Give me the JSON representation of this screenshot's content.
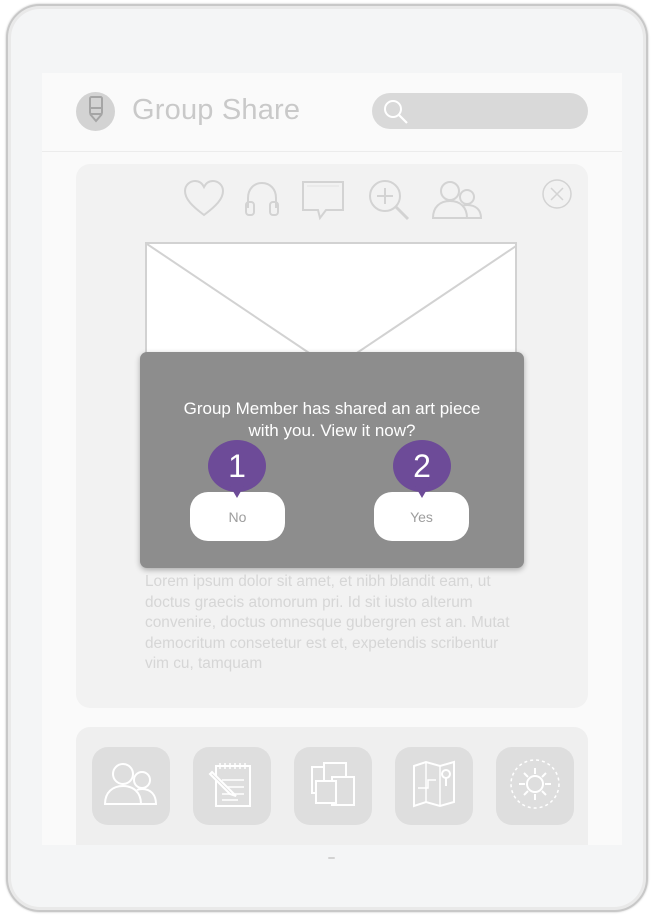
{
  "app": {
    "title": "Group Share",
    "logo_icon": "pencil-icon"
  },
  "search": {
    "placeholder": "",
    "icon": "search-icon"
  },
  "card": {
    "actions": [
      {
        "name": "heart-icon"
      },
      {
        "name": "headphones-icon"
      },
      {
        "name": "comment-icon"
      },
      {
        "name": "zoom-in-icon"
      },
      {
        "name": "group-icon"
      }
    ],
    "close_icon": "close-icon",
    "body_text": "Lorem ipsum dolor sit amet, et nibh blandit eam, ut doctus graecis atomorum pri. Id sit iusto alterum convenire, doctus omnesque gubergren est an. Mutat democritum consetetur est et, expetendis scribentur vim cu, tamquam"
  },
  "modal": {
    "message_line1": "Group Member has shared an art piece",
    "message_line2": "with you. View it now?",
    "no_label": "No",
    "yes_label": "Yes",
    "marker_no": "1",
    "marker_yes": "2"
  },
  "dock": {
    "items": [
      {
        "name": "members-icon"
      },
      {
        "name": "notes-icon"
      },
      {
        "name": "gallery-icon"
      },
      {
        "name": "map-icon"
      },
      {
        "name": "settings-icon"
      }
    ]
  },
  "colors": {
    "modal_bg": "#8d8d8d",
    "marker": "#6d4b98",
    "placeholder_text": "#d6d6d6"
  }
}
